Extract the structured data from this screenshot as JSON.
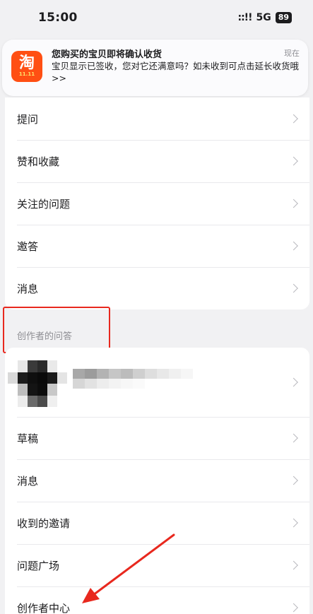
{
  "status_bar": {
    "time": "15:00",
    "signal": "::!!",
    "network": "5G",
    "battery": "89"
  },
  "notification": {
    "app_icon": "taobao-app-icon",
    "app_glyph": "淘",
    "app_subtext": "11.11",
    "title": "您购买的宝贝即将确认收货",
    "time": "现在",
    "body": "宝贝显示已签收，您对它还满意吗？如未收到可点击延长收货哦>>"
  },
  "menu_main": {
    "items": [
      {
        "label": "提问"
      },
      {
        "label": "赞和收藏"
      },
      {
        "label": "关注的问题"
      },
      {
        "label": "邀答"
      },
      {
        "label": "消息"
      }
    ]
  },
  "creator_section": {
    "header": "创作者的问答",
    "profile_row": {
      "avatar": "pixelated-avatar",
      "name": "pixelated-name"
    },
    "items": [
      {
        "label": "草稿"
      },
      {
        "label": "消息"
      },
      {
        "label": "收到的邀请"
      },
      {
        "label": "问题广场"
      },
      {
        "label": "创作者中心"
      }
    ]
  },
  "annotations": {
    "highlight_color": "#e8281e",
    "arrow_color": "#e8281e"
  }
}
